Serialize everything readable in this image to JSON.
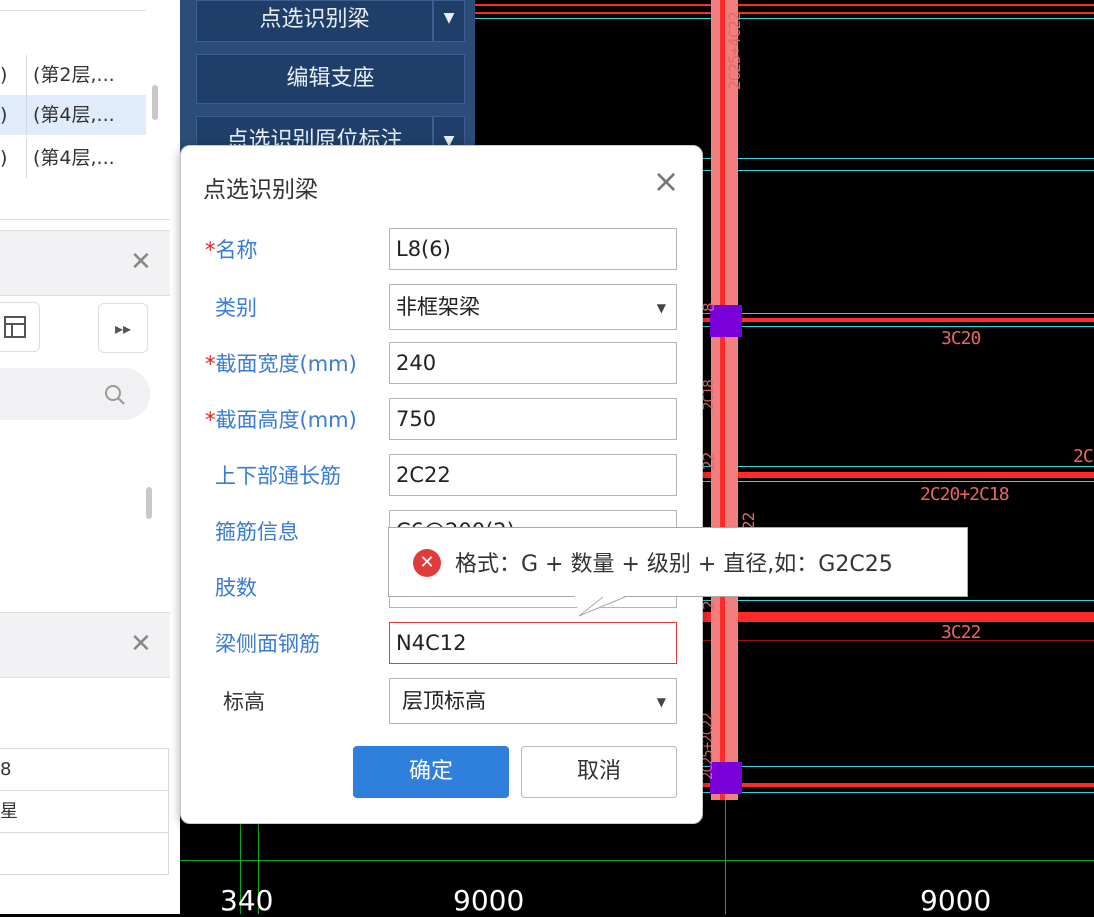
{
  "left_panel": {
    "rows": [
      {
        "c1": ")",
        "c2": "(第2层,..."
      },
      {
        "c1": ")",
        "c2": "(第4层,..."
      },
      {
        "c1": ")",
        "c2": "(第4层,..."
      }
    ],
    "table_rows": [
      {
        "text": "8"
      },
      {
        "text": "星"
      },
      {
        "text": ""
      }
    ]
  },
  "toolbar": {
    "btn1": "点选识别梁",
    "btn2": "编辑支座",
    "btn3": "点选识别原位标注"
  },
  "cad": {
    "labels": {
      "v_top": "2C25+4C22",
      "b1": "3C20",
      "b2": "2C20+2C18",
      "b3": "3C22",
      "edge_2c": "2C",
      "v_mid1": "2C18",
      "v_mid2": "22",
      "v_mid3": "8",
      "v_mid4": "22",
      "v_bot": "2C25+2C22",
      "v_mid5": "2"
    },
    "dimensions": {
      "d340": "340",
      "d9000a": "9000",
      "d9000b": "9000"
    }
  },
  "dialog": {
    "title": "点选识别梁",
    "fields": {
      "name": {
        "label": "名称",
        "value": "L8(6)",
        "required": true
      },
      "category": {
        "label": "类别",
        "value": "非框架梁"
      },
      "width": {
        "label": "截面宽度(mm)",
        "value": "240",
        "required": true
      },
      "height": {
        "label": "截面高度(mm)",
        "value": "750",
        "required": true
      },
      "through": {
        "label": "上下部通长筋",
        "value": "2C22"
      },
      "stirrup": {
        "label": "箍筋信息",
        "value": "C6@200(2)"
      },
      "legs": {
        "label": "肢数",
        "value": ""
      },
      "side": {
        "label": "梁侧面钢筋",
        "value": "N4C12"
      },
      "elev": {
        "label": "标高",
        "value": "层顶标高"
      }
    },
    "ok": "确定",
    "cancel": "取消"
  },
  "tooltip": {
    "text": "格式：G + 数量 + 级别 + 直径,如：G2C25"
  },
  "colors": {
    "primary": "#2f7fdc",
    "error": "#e23b3b",
    "label_blue": "#3a7bd5",
    "toolbar_bg": "#2c4c7a",
    "beam_red": "#ff2a2a",
    "beam_cyan": "#39d3de",
    "purple": "#7a00d9"
  }
}
